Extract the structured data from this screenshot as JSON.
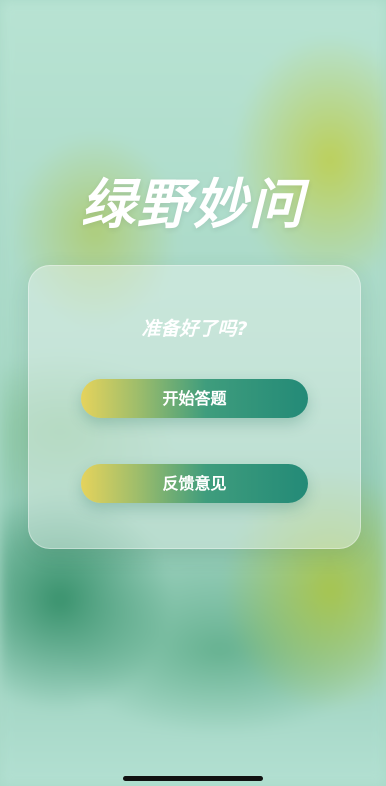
{
  "app": {
    "title": "绿野妙问"
  },
  "card": {
    "question": "准备好了吗?",
    "buttons": {
      "start_label": "开始答题",
      "feedback_label": "反馈意见"
    }
  },
  "colors": {
    "button_gradient_start": "#e5d35c",
    "button_gradient_end": "#238a77",
    "text": "#ffffff"
  }
}
